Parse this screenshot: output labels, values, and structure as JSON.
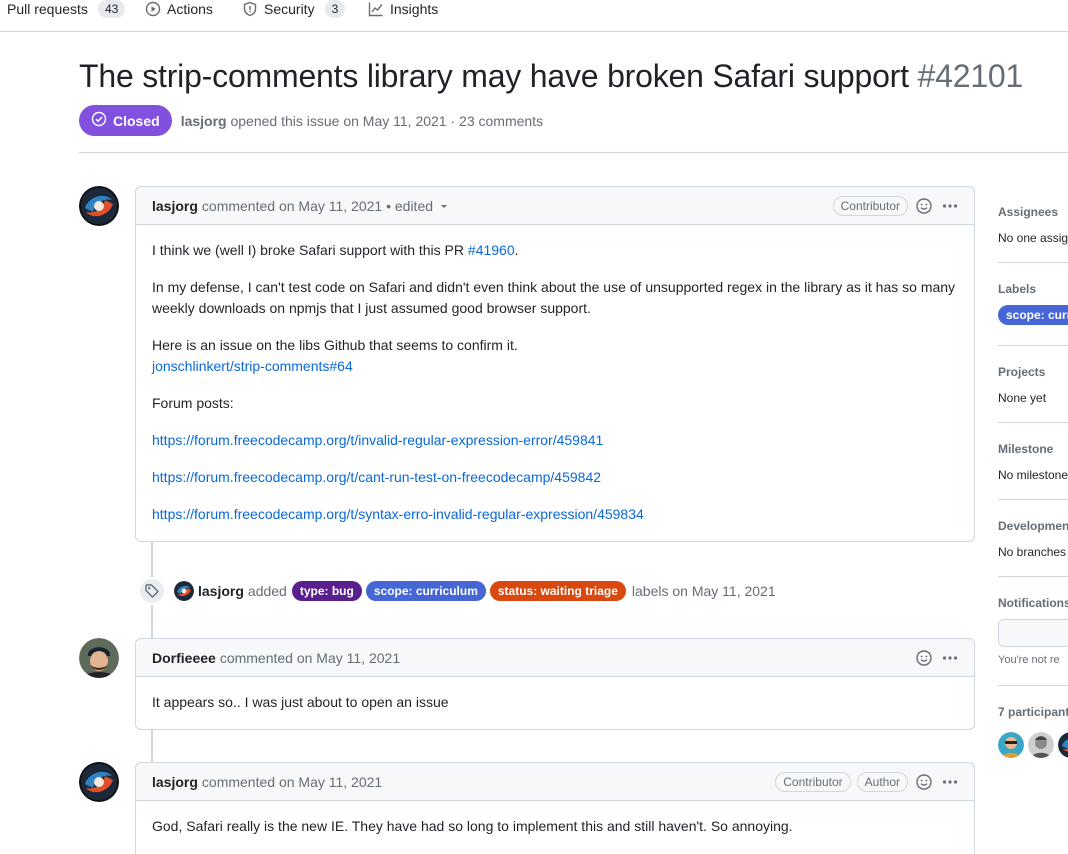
{
  "nav": {
    "pull_requests": {
      "label": "Pull requests",
      "count": "43"
    },
    "actions": {
      "label": "Actions"
    },
    "security": {
      "label": "Security",
      "count": "3"
    },
    "insights": {
      "label": "Insights"
    }
  },
  "issue": {
    "title": "The strip-comments library may have broken Safari support",
    "number": "#42101",
    "state": "Closed",
    "author": "lasjorg",
    "opened_text": "opened this issue on May 11, 2021 · 23 comments"
  },
  "comments": [
    {
      "author": "lasjorg",
      "meta": "commented on May 11, 2021 • edited",
      "badges": [
        "Contributor"
      ],
      "p1_text": "I think we (well I) broke Safari support with this PR ",
      "p1_link": "#41960",
      "p1_end": ".",
      "p2": "In my defense, I can't test code on Safari and didn't even think about the use of unsupported regex in the library as it has so many weekly downloads on npmjs that I just assumed good browser support.",
      "p3_text": "Here is an issue on the libs Github that seems to confirm it.",
      "p3_link": "jonschlinkert/strip-comments#64",
      "p4": "Forum posts:",
      "links": [
        "https://forum.freecodecamp.org/t/invalid-regular-expression-error/459841",
        "https://forum.freecodecamp.org/t/cant-run-test-on-freecodecamp/459842",
        "https://forum.freecodecamp.org/t/syntax-erro-invalid-regular-expression/459834"
      ]
    },
    {
      "author": "Dorfieeee",
      "meta": "commented on May 11, 2021",
      "body": "It appears so.. I was just about to open an issue"
    },
    {
      "author": "lasjorg",
      "meta": "commented on May 11, 2021",
      "badges": [
        "Contributor",
        "Author"
      ],
      "body": "God, Safari really is the new IE. They have had so long to implement this and still haven't. So annoying."
    }
  ],
  "event": {
    "actor": "lasjorg",
    "verb": "added",
    "labels": [
      {
        "name": "type: bug",
        "color": "#5a1f8e"
      },
      {
        "name": "scope: curriculum",
        "color": "#4666d6"
      },
      {
        "name": "status: waiting triage",
        "color": "#d9480f"
      }
    ],
    "suffix": "labels on May 11, 2021"
  },
  "sidebar": {
    "assignees": {
      "heading": "Assignees",
      "value": "No one assig"
    },
    "labels": {
      "heading": "Labels",
      "value": "scope: curri"
    },
    "projects": {
      "heading": "Projects",
      "value": "None yet"
    },
    "milestone": {
      "heading": "Milestone",
      "value": "No milestone"
    },
    "development": {
      "heading": "Developmen",
      "value": "No branches"
    },
    "notifications": {
      "heading": "Notifications",
      "value": "You're not re"
    },
    "participants": {
      "heading": "7 participant"
    }
  },
  "colors": {
    "closed": "#8250df",
    "link": "#0969da",
    "border": "#d0d7de"
  }
}
